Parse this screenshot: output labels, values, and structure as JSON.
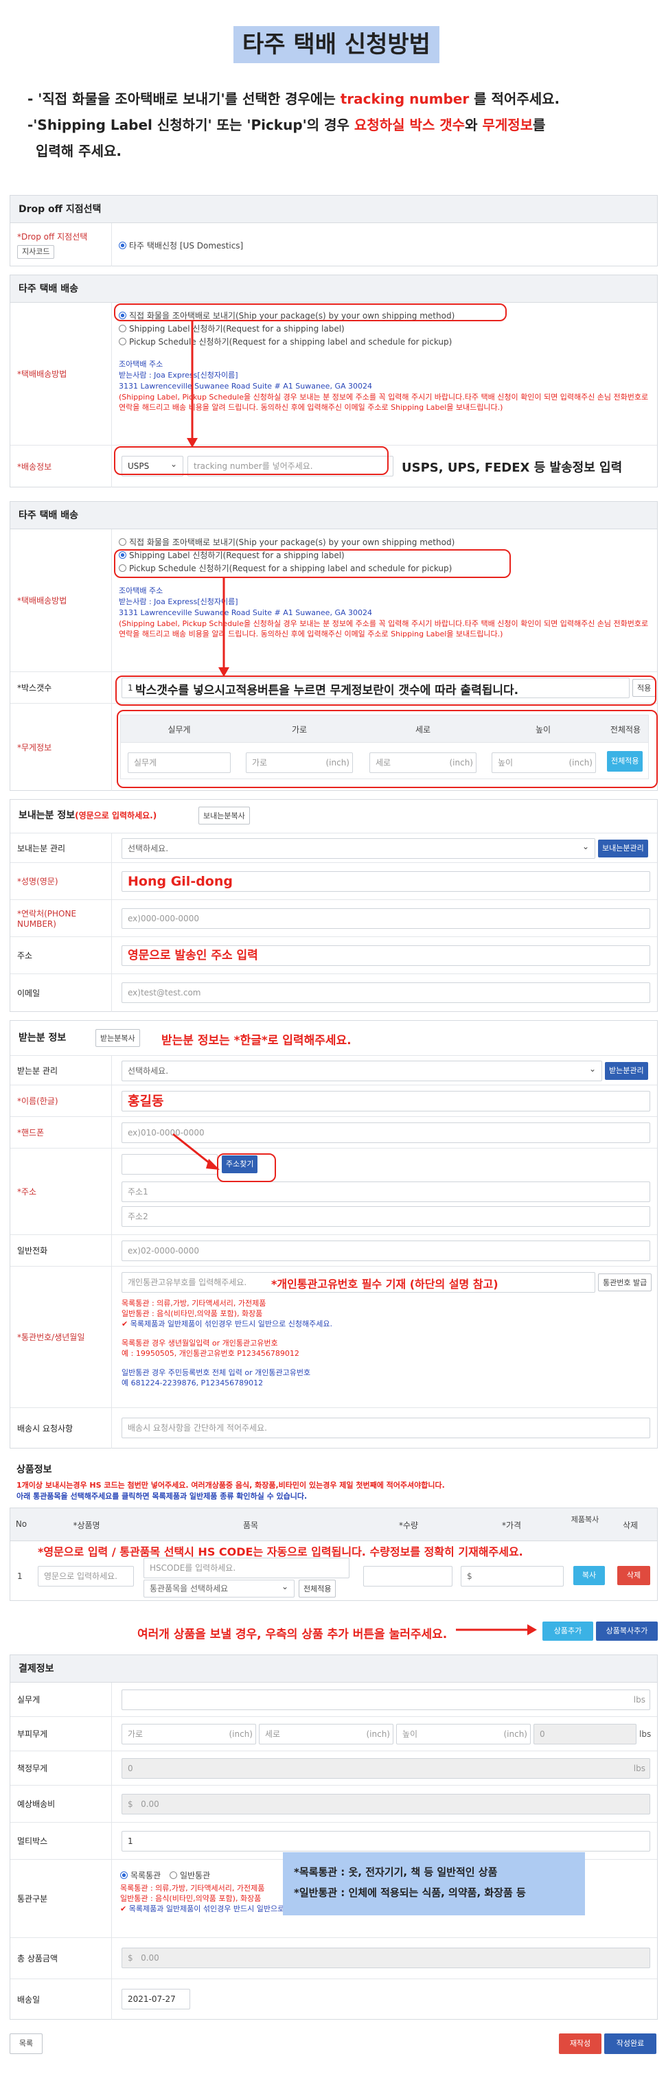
{
  "page_title": "타주 택배 신청방법",
  "intro": {
    "line1_pre": "- '직접 화물을 조아택배로 보내기'를 선택한 경우에는 ",
    "line1_red": "tracking number",
    "line1_post": " 를 적어주세요.",
    "line2_pre": "-'Shipping Label 신청하기' 또는 'Pickup'의 경우 ",
    "line2_red1": "요청하실 박스 갯수",
    "line2_mid": "와 ",
    "line2_red2": "무게정보",
    "line2_post": "를",
    "line3": "입력해 주세요."
  },
  "dropoff": {
    "title": "Drop off 지점선택",
    "label": "*Drop off 지점선택",
    "code_btn": "지사코드",
    "option": "타주 택배신청 [US Domestics]"
  },
  "ship1": {
    "title": "타주 택배 배송",
    "method_label": "*택배배송방법",
    "options": [
      "직접 화물을 조아택배로 보내기(Ship your package(s) by your own shipping method)",
      "Shipping Label 신청하기(Request for a shipping label)",
      "Pickup Schedule 신청하기(Request for a shipping label and schedule for pickup)"
    ],
    "addr_title": "조아택배 주소",
    "addr_recv": "받는사람 : Joa Express[신청자이름]",
    "addr_line": "3131 Lawrenceville Suwanee Road Suite # A1 Suwanee, GA 30024",
    "addr_note": "(Shipping Label, Pickup Schedule을 신청하실 경우 보내는 분 정보에 주소를 꼭 입력해 주시기 바랍니다.타주 택배 신청이 확인이 되면 입력해주신 손님 전화번호로 연락을 해드리고 배송 비용을 알려 드립니다. 동의하신 후에 입력해주신 이메일 주소로 Shipping Label을 보내드립니다.)",
    "info_label": "*배송정보",
    "carrier": "USPS",
    "tracking_ph": "tracking number를 넣어주세요.",
    "anno": "USPS, UPS, FEDEX 등 발송정보 입력"
  },
  "ship2": {
    "title": "타주 택배 배송",
    "method_label": "*택배배송방법",
    "box_label": "*박스갯수",
    "box_value": "1",
    "box_anno": "박스갯수를 넣으시고적용버튼을 누르면 무게정보란이 갯수에 따라 출력됩니다.",
    "apply_btn": "적용",
    "weight_label": "*무게정보",
    "weight_headers": [
      "실무게",
      "가로",
      "세로",
      "높이",
      "전체적용"
    ],
    "weight_ph": [
      "실무게",
      "가로",
      "세로",
      "높이"
    ],
    "inch": "(inch)",
    "apply_all_btn": "전체적용"
  },
  "sender": {
    "title": "보내는분 정보",
    "title_note": "(영문으로 입력하세요.)",
    "copy_btn": "보내는분복사",
    "manage_label": "보내는분 관리",
    "manage_sel": "선택하세요.",
    "manage_btn": "보내는분관리",
    "name_label": "*성명(영문)",
    "name_value": "Hong Gil-dong",
    "phone_label": "*연락처(PHONE NUMBER)",
    "phone_ph": "ex)000-000-0000",
    "addr_label": "주소",
    "addr_value": "영문으로 발송인 주소 입력",
    "email_label": "이메일",
    "email_ph": "ex)test@test.com"
  },
  "receiver": {
    "title": "받는분 정보",
    "copy_btn": "받는분복사",
    "anno": "받는분 정보는 *한글*로 입력해주세요.",
    "manage_label": "받는분 관리",
    "manage_sel": "선택하세요.",
    "manage_btn": "받는분관리",
    "name_label": "*이름(한글)",
    "name_value": "홍길동",
    "mobile_label": "*핸드폰",
    "mobile_ph": "ex)010-0000-0000",
    "addr_label": "*주소",
    "find_btn": "주소찾기",
    "addr1_ph": "주소1",
    "addr2_ph": "주소2",
    "tel_label": "일반전화",
    "tel_ph": "ex)02-0000-0000",
    "customs_label": "*통관번호/생년월일",
    "customs_ph": "개인통관고유부호를 입력해주세요.",
    "customs_anno": "*개인통관고유번호 필수 기재 (하단의 설명 참고)",
    "customs_btn": "통관번호 발급",
    "customs_note1": "목록통관 : 의류,가방, 기타액세서리, 가전제품",
    "customs_note2": "일반통관 : 음식(비타민,의약품 포함), 화장품",
    "customs_note3": "목록제품과 일반제품이 섞인경우 반드시 일반으로 신청해주세요.",
    "customs_note4": "목록통관 경우 생년월일입력 or 개인통관고유번호",
    "customs_note5": "예 : 19950505, 개인통관고유번호 P123456789012",
    "customs_note6": "일반통관 경우 주민등록번호 전체 입력 or 개인통관고유번호",
    "customs_note7": "예 681224-2239876, P123456789012",
    "request_label": "배송시 요청사항",
    "request_ph": "배송시 요청사항을 간단하게 적어주세요."
  },
  "goods": {
    "title": "상품정보",
    "note1": "1개이상 보내시는경우 HS 코드는 첨번만 넣어주세요. 여러개상품중 음식, 화장품,비타민이 있는경우 제일 첫번째에 적어주셔야합니다.",
    "note2": "아래 통관품목을 선택해주세요를 클릭하면 목록제품과 일반제품 종류 확인하실 수 있습니다.",
    "headers": [
      "No",
      "*상품명",
      "품목",
      "*수량",
      "*가격",
      "제품복사",
      "삭제"
    ],
    "anno": "*영문으로 입력 / 통관품목 선택시 HS CODE는 자동으로 입력됩니다. 수량정보를 정확히 기재해주세요.",
    "row_no": "1",
    "name_ph": "영문으로 입력하세요.",
    "hs_ph": "HSCODE를 입력하세요.",
    "cat_sel": "통관품목을 선택하세요",
    "cat_btn": "전체적용",
    "price_prefix": "$",
    "copy_btn": "복사",
    "delete_btn": "삭제",
    "add_anno": "여러개 상품을 보낼 경우, 우측의 상품 추가 버튼을 눌러주세요.",
    "add_btn": "상품추가",
    "copy_add_btn": "상품복사추가"
  },
  "payment": {
    "title": "결제정보",
    "actual_label": "실무게",
    "vol_label": "부피무게",
    "billed_label": "책정무게",
    "billed_value": "0",
    "est_label": "예상배송비",
    "est_value": "0.00",
    "multi_label": "멀티박스",
    "multi_value": "1",
    "customs_type_label": "통관구분",
    "customs_opt1": "목록통관",
    "customs_opt2": "일반통관",
    "total_label": "총 상품금액",
    "total_value": "0.00",
    "date_label": "배송일",
    "date_value": "2021-07-27",
    "lbs": "lbs",
    "w_ph": "가로",
    "l_ph": "세로",
    "h_ph": "높이",
    "inch": "(inch)",
    "vol_value": "0",
    "dollar": "$",
    "info1": "*목록통관 : 옷, 전자기기, 책 등 일반적인 상품",
    "info2": "*일반통관 : 인체에 적용되는 식품, 의약품, 화장품 등"
  },
  "footer": {
    "list_btn": "목록",
    "rewrite_btn": "재작성",
    "submit_btn": "작성완료"
  },
  "colors": {
    "accent": "#2f5fb3",
    "annotation": "#e8231d",
    "header_bg": "#b9cff1"
  }
}
